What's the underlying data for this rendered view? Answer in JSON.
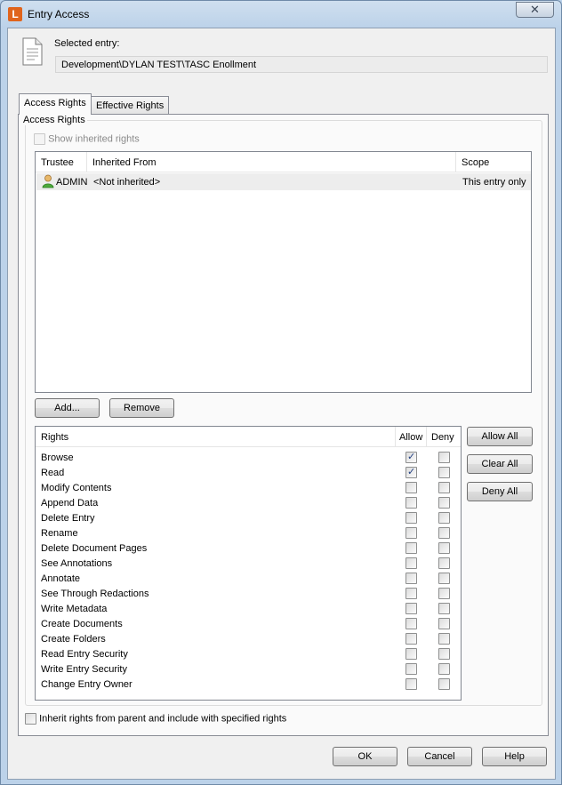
{
  "window": {
    "title": "Entry Access",
    "app_icon_letter": "L",
    "close_symbol": "✕"
  },
  "selected": {
    "label": "Selected entry:",
    "path": "Development\\DYLAN TEST\\TASC Enollment"
  },
  "tabs": [
    {
      "label": "Access Rights"
    },
    {
      "label": "Effective Rights"
    }
  ],
  "access": {
    "group_title": "Access Rights",
    "show_inherited_label": "Show inherited rights",
    "columns": {
      "trustee": "Trustee",
      "inherited_from": "Inherited From",
      "scope": "Scope"
    },
    "rows": [
      {
        "trustee": "ADMIN",
        "inherited_from": "<Not inherited>",
        "scope": "This entry only"
      }
    ],
    "add_label": "Add...",
    "remove_label": "Remove"
  },
  "rights": {
    "col_rights": "Rights",
    "col_allow": "Allow",
    "col_deny": "Deny",
    "items": [
      {
        "name": "Browse",
        "allow": true,
        "deny": false
      },
      {
        "name": "Read",
        "allow": true,
        "deny": false
      },
      {
        "name": "Modify Contents",
        "allow": false,
        "deny": false
      },
      {
        "name": "Append Data",
        "allow": false,
        "deny": false
      },
      {
        "name": "Delete Entry",
        "allow": false,
        "deny": false
      },
      {
        "name": "Rename",
        "allow": false,
        "deny": false
      },
      {
        "name": "Delete Document Pages",
        "allow": false,
        "deny": false
      },
      {
        "name": "See Annotations",
        "allow": false,
        "deny": false
      },
      {
        "name": "Annotate",
        "allow": false,
        "deny": false
      },
      {
        "name": "See Through Redactions",
        "allow": false,
        "deny": false
      },
      {
        "name": "Write Metadata",
        "allow": false,
        "deny": false
      },
      {
        "name": "Create Documents",
        "allow": false,
        "deny": false
      },
      {
        "name": "Create Folders",
        "allow": false,
        "deny": false
      },
      {
        "name": "Read Entry Security",
        "allow": false,
        "deny": false
      },
      {
        "name": "Write Entry Security",
        "allow": false,
        "deny": false
      },
      {
        "name": "Change Entry Owner",
        "allow": false,
        "deny": false
      }
    ],
    "allow_all_label": "Allow All",
    "clear_all_label": "Clear All",
    "deny_all_label": "Deny All"
  },
  "inherit_label": "Inherit rights from parent and include with specified rights",
  "footer": {
    "ok_label": "OK",
    "cancel_label": "Cancel",
    "help_label": "Help"
  }
}
